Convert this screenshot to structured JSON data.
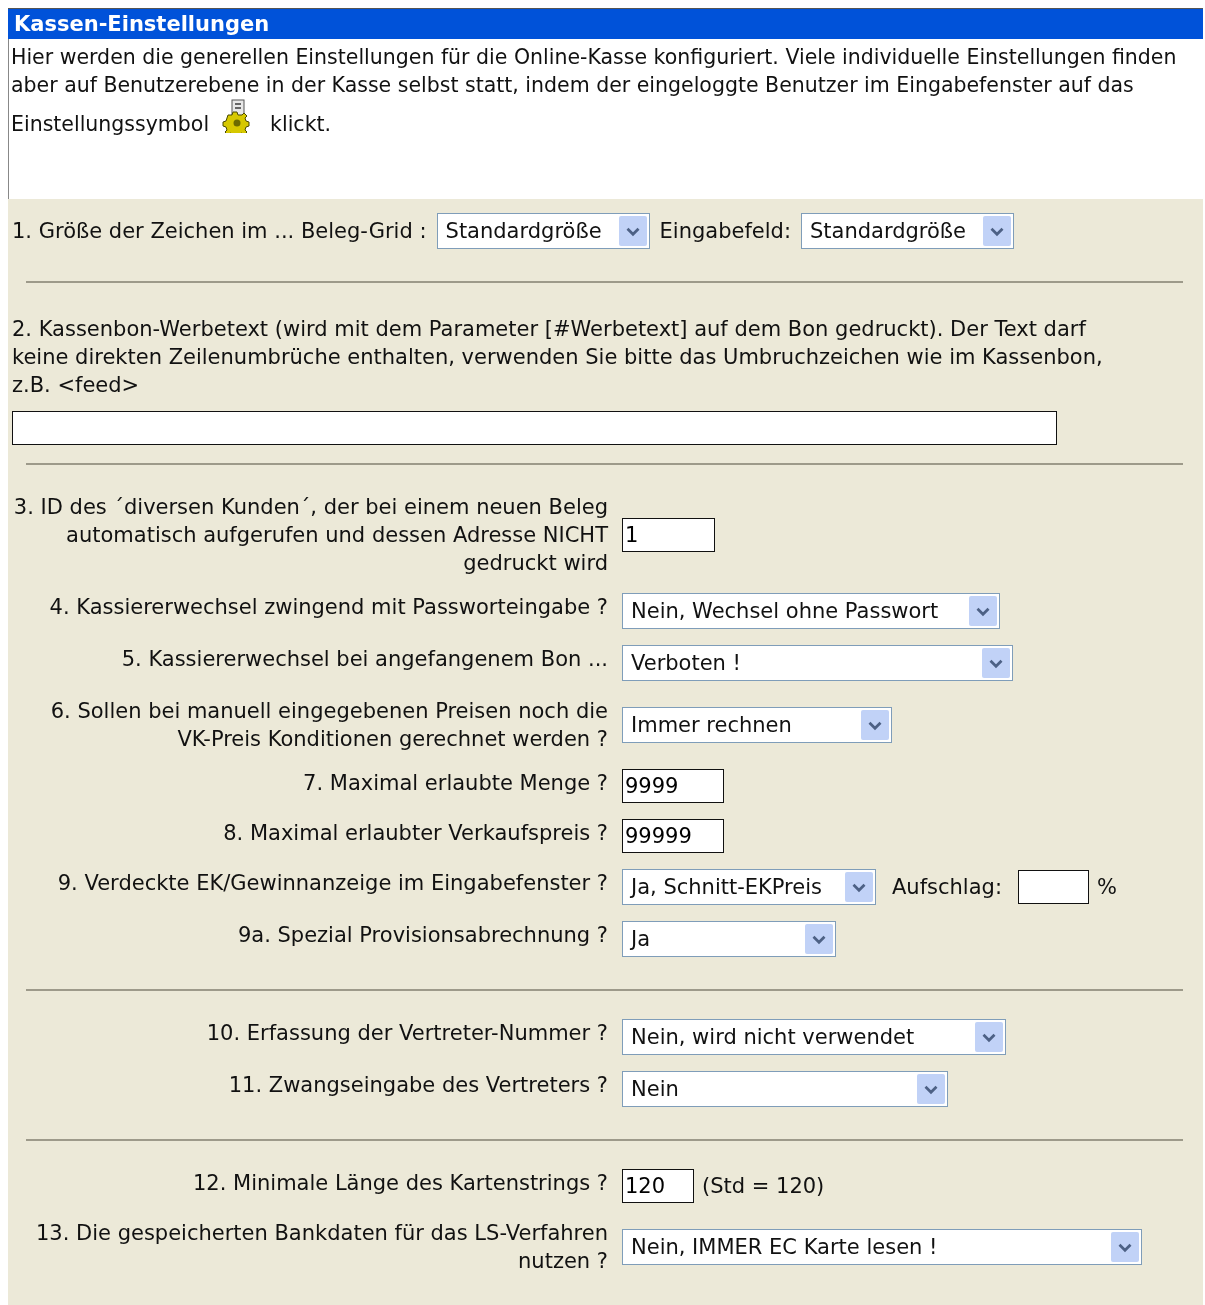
{
  "title": "Kassen-Einstellungen",
  "intro": {
    "text": "Hier werden die generellen Einstellungen für die Online-Kasse konfiguriert. Viele individuelle Einstellungen finden aber auf Benutzerebene in der Kasse selbst statt, indem der eingeloggte Benutzer im Eingabefenster auf das Einstellungssymbol",
    "after_icon": "klickt."
  },
  "groups": [
    {
      "kind": "inline",
      "items": [
        {
          "kind": "label",
          "text": "1. Größe der Zeichen im ... Beleg-Grid :"
        },
        {
          "kind": "select",
          "value": "Standardgröße"
        },
        {
          "kind": "label",
          "text": "Eingabefeld:"
        },
        {
          "kind": "select",
          "value": "Standardgröße"
        }
      ]
    },
    {
      "kind": "paragraph",
      "text": "2. Kassenbon-Werbetext (wird mit dem Parameter [#Werbetext] auf dem Bon gedruckt). Der Text darf keine direkten Zeilenumbrüche enthalten, verwenden Sie bitte das Umbruchzeichen wie im Kassenbon, z.B. <feed>"
    },
    {
      "kind": "form",
      "rows": [
        {
          "label": [
            "3. ID des ´diversen Kunden´, der bei einem neuen Beleg",
            "automatisch aufgerufen und dessen Adresse NICHT gedruckt wird"
          ],
          "controls": [
            {
              "kind": "field",
              "value": "1"
            }
          ]
        },
        {
          "label": [
            "4. Kassiererwechsel zwingend mit Passworteingabe ?"
          ],
          "controls": [
            {
              "kind": "select",
              "value": "Nein, Wechsel ohne Passwort"
            }
          ]
        },
        {
          "label": [
            "5. Kassiererwechsel bei angefangenem Bon ..."
          ],
          "controls": [
            {
              "kind": "select",
              "value": "Verboten !"
            }
          ]
        },
        {
          "label": [
            "6. Sollen bei manuell eingegebenen Preisen noch die VK-Preis Konditionen gerechnet werden ?"
          ],
          "controls": [
            {
              "kind": "select",
              "value": "Immer rechnen"
            }
          ]
        },
        {
          "label": [
            "7. Maximal erlaubte Menge ?"
          ],
          "controls": [
            {
              "kind": "field",
              "value": "9999"
            }
          ]
        },
        {
          "label": [
            "8. Maximal erlaubter Verkaufspreis ?"
          ],
          "controls": [
            {
              "kind": "field",
              "value": "99999"
            }
          ]
        },
        {
          "label": [
            "9. Verdeckte EK/Gewinnanzeige im Eingabefenster ?"
          ],
          "controls": [
            {
              "kind": "select",
              "value": "Ja, Schnitt-EKPreis"
            },
            {
              "kind": "label",
              "text": "Aufschlag:"
            },
            {
              "kind": "field"
            },
            {
              "kind": "note",
              "text": "%"
            }
          ]
        },
        {
          "label": [
            "9a. Spezial Provisionsabrechnung ?"
          ],
          "controls": [
            {
              "kind": "select",
              "value": "Ja"
            }
          ]
        }
      ]
    },
    {
      "kind": "form",
      "rows": [
        {
          "label": [
            "10. Erfassung der Vertreter-Nummer ?"
          ],
          "controls": [
            {
              "kind": "select",
              "value": "Nein, wird nicht verwendet"
            }
          ]
        },
        {
          "label": [
            "11. Zwangseingabe des Vertreters ?"
          ],
          "controls": [
            {
              "kind": "select",
              "value": "Nein"
            }
          ]
        }
      ]
    },
    {
      "kind": "form",
      "rows": [
        {
          "label": [
            "12. Minimale Länge des Kartenstrings ?"
          ],
          "controls": [
            {
              "kind": "field",
              "value": "120"
            },
            {
              "kind": "note",
              "text": "(Std = 120)"
            }
          ]
        },
        {
          "label": [
            "13. Die gespeicherten Bankdaten für das LS-Verfahren nutzen ?"
          ],
          "controls": [
            {
              "kind": "select",
              "value": "Nein, IMMER EC Karte lesen !"
            }
          ]
        }
      ]
    }
  ]
}
